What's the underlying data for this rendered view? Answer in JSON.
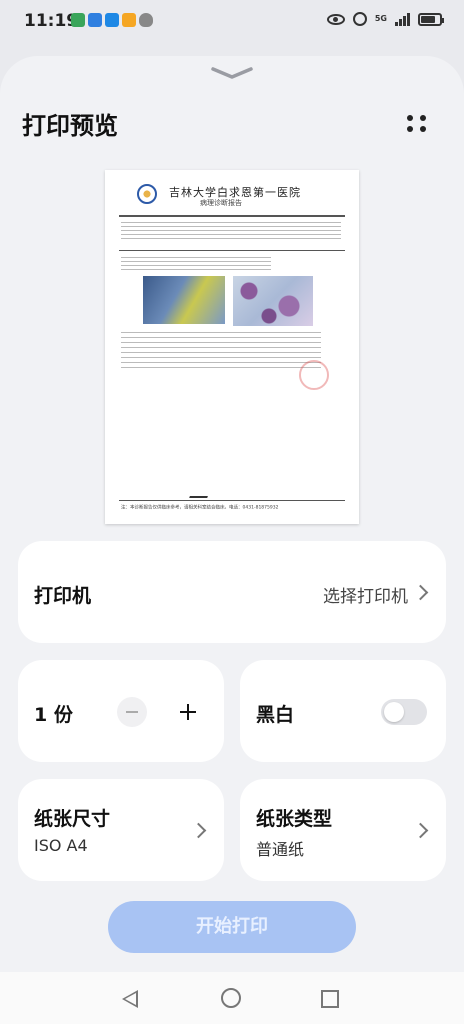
{
  "status_bar": {
    "time": "11:19",
    "signal_label": "5G"
  },
  "header": {
    "title": "打印预览"
  },
  "preview": {
    "hospital_name": "吉林大学白求恩第一医院",
    "report_title": "病理诊断报告",
    "footer_note": "注：本诊断报告仅供临床参考，请相关科室结合临床。电话：0431-81875932"
  },
  "printer": {
    "label": "打印机",
    "value": "选择打印机"
  },
  "copies": {
    "label": "1 份"
  },
  "color_mode": {
    "label": "黑白",
    "enabled": false
  },
  "paper_size": {
    "label": "纸张尺寸",
    "value": "ISO A4"
  },
  "paper_type": {
    "label": "纸张类型",
    "value": "普通纸"
  },
  "actions": {
    "start_label": "开始打印"
  },
  "colors": {
    "accent": "#a8c3f3",
    "background": "#f1f2f5",
    "card": "#ffffff"
  }
}
